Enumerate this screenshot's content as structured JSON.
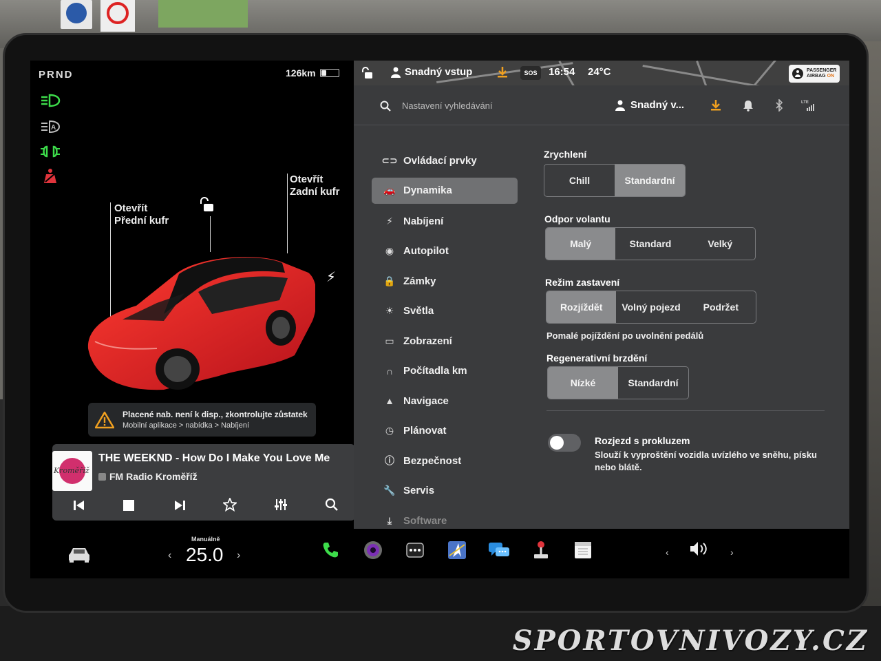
{
  "left_panel": {
    "gear": "PRND",
    "range": "126km",
    "battery_level": 0.3,
    "labels": {
      "front_trunk_line1": "Otevřít",
      "front_trunk_line2": "Přední kufr",
      "rear_trunk_line1": "Otevřít",
      "rear_trunk_line2": "Zadní kufr"
    },
    "alert": {
      "line1": "Placené nab. není k disp., zkontrolujte zůstatek",
      "line2": "Mobilní aplikace > nabídka > Nabíjení"
    },
    "media": {
      "art_text": "Kroměříž",
      "track": "THE WEEKND - How Do I Make You Love Me",
      "station": "FM Radio Kroměříž"
    }
  },
  "top_bar": {
    "profile": "Snadný vstup",
    "sos": "SOS",
    "time": "16:54",
    "temperature": "24°C",
    "airbag_line1": "PASSENGER",
    "airbag_line2": "AIRBAG",
    "airbag_status": "ON"
  },
  "search": {
    "placeholder": "Nastavení vyhledávání",
    "user": "Snadný v..."
  },
  "nav": {
    "items": [
      {
        "label": "Ovládací prvky",
        "icon": "toggle-icon"
      },
      {
        "label": "Dynamika",
        "icon": "car-icon"
      },
      {
        "label": "Nabíjení",
        "icon": "bolt-icon"
      },
      {
        "label": "Autopilot",
        "icon": "steering-wheel-icon"
      },
      {
        "label": "Zámky",
        "icon": "lock-icon"
      },
      {
        "label": "Světla",
        "icon": "sun-icon"
      },
      {
        "label": "Zobrazení",
        "icon": "display-icon"
      },
      {
        "label": "Počítadla km",
        "icon": "odometer-icon"
      },
      {
        "label": "Navigace",
        "icon": "navigation-icon"
      },
      {
        "label": "Plánovat",
        "icon": "clock-icon"
      },
      {
        "label": "Bezpečnost",
        "icon": "info-icon"
      },
      {
        "label": "Servis",
        "icon": "wrench-icon"
      },
      {
        "label": "Software",
        "icon": "download-icon"
      }
    ],
    "active": "Dynamika"
  },
  "settings": {
    "acceleration": {
      "title": "Zrychlení",
      "options": [
        "Chill",
        "Standardní"
      ],
      "selected": "Standardní"
    },
    "steering": {
      "title": "Odpor volantu",
      "options": [
        "Malý",
        "Standard",
        "Velký"
      ],
      "selected": "Malý"
    },
    "stopping": {
      "title": "Režim zastavení",
      "options": [
        "Rozjíždět",
        "Volný pojezd",
        "Podržet"
      ],
      "selected": "Rozjíždět",
      "note": "Pomalé pojíždění po uvolnění pedálů"
    },
    "regen": {
      "title": "Regenerativní brzdění",
      "options": [
        "Nízké",
        "Standardní"
      ],
      "selected": "Nízké"
    },
    "slip_start": {
      "title": "Rozjezd s prokluzem",
      "description": "Slouží k vyproštění vozidla uvízlého ve sněhu, písku nebo blátě.",
      "enabled": false
    }
  },
  "taskbar": {
    "climate_mode": "Manuálně",
    "climate_temp": "25.0"
  },
  "watermark": "SPORTOVNIVOZY.CZ",
  "colors": {
    "car_red": "#e31e24",
    "accent_orange": "#f0a020",
    "indicator_green": "#3ddc4b",
    "seatbelt_red": "#e0343c"
  }
}
